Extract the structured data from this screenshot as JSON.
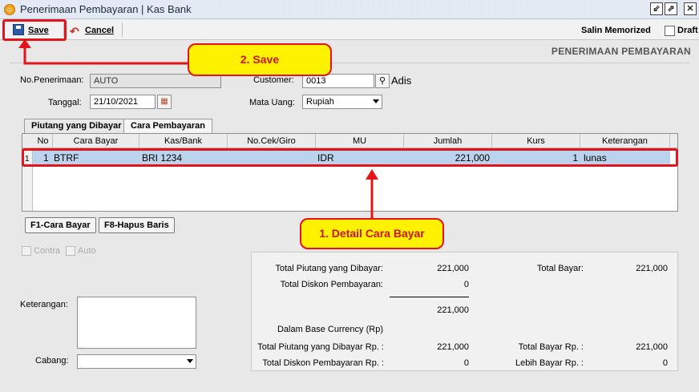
{
  "window": {
    "title": "Penerimaan Pembayaran | Kas Bank",
    "controls": [
      "restore-icon",
      "maximize-icon",
      "close-icon"
    ]
  },
  "toolbar": {
    "save_label": "Save",
    "cancel_label": "Cancel",
    "salin_label": "Salin Memorized",
    "draft_label": "Draft"
  },
  "form_title": "PENERIMAAN PEMBAYARAN",
  "header": {
    "no_penerimaan_label": "No.Penerimaan:",
    "no_penerimaan_value": "AUTO",
    "tanggal_label": "Tanggal:",
    "tanggal_value": "21/10/2021",
    "customer_label": "Customer:",
    "customer_value": "0013",
    "customer_name": "Adis",
    "mata_uang_label": "Mata Uang:",
    "mata_uang_value": "Rupiah"
  },
  "tabs": [
    {
      "label": "Piutang yang Dibayar",
      "active": false
    },
    {
      "label": "Cara Pembayaran",
      "active": true
    }
  ],
  "grid": {
    "columns": [
      "No",
      "Cara Bayar",
      "Kas/Bank",
      "No.Cek/Giro",
      "MU",
      "Jumlah",
      "Kurs",
      "Keterangan"
    ],
    "row_marker": "1",
    "rows": [
      {
        "no": "1",
        "cara_bayar": "BTRF",
        "kas_bank": "BRI 1234",
        "no_cek": "",
        "mu": "IDR",
        "jumlah": "221,000",
        "kurs": "1",
        "keterangan": "lunas"
      }
    ]
  },
  "buttons": {
    "f1": "F1-Cara Bayar",
    "f8": "F8-Hapus Baris"
  },
  "checkboxes": {
    "contra": "Contra",
    "auto": "Auto"
  },
  "bottom": {
    "keterangan_label": "Keterangan:",
    "cabang_label": "Cabang:"
  },
  "summary": {
    "total_piutang_label": "Total Piutang yang Dibayar:",
    "total_piutang_value": "221,000",
    "total_diskon_label": "Total Diskon Pembayaran:",
    "total_diskon_value": "0",
    "subtotal_value": "221,000",
    "base_currency_label": "Dalam Base Currency (Rp)",
    "total_piutang_rp_label": "Total Piutang yang Dibayar Rp. :",
    "total_piutang_rp_value": "221,000",
    "total_diskon_rp_label": "Total Diskon Pembayaran Rp. :",
    "total_diskon_rp_value": "0",
    "total_bayar_label": "Total Bayar:",
    "total_bayar_value": "221,000",
    "total_bayar_rp_label": "Total Bayar Rp. :",
    "total_bayar_rp_value": "221,000",
    "lebih_bayar_rp_label": "Lebih Bayar Rp. :",
    "lebih_bayar_rp_value": "0"
  },
  "annotations": {
    "save_callout": "2. Save",
    "detail_callout": "1. Detail Cara Bayar",
    "color": "#e3151a",
    "bubble_fill": "#fff200"
  }
}
